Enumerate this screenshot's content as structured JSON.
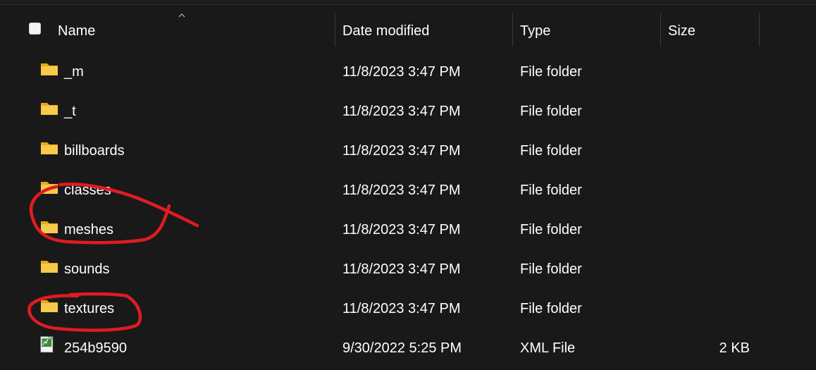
{
  "header": {
    "columns": [
      {
        "label": "Name"
      },
      {
        "label": "Date modified"
      },
      {
        "label": "Type"
      },
      {
        "label": "Size"
      }
    ],
    "sort_indicator_icon": "chevron-up-icon"
  },
  "rows": [
    {
      "name": "_m",
      "date": "11/8/2023 3:47 PM",
      "type": "File folder",
      "size": "",
      "icon": "folder-icon"
    },
    {
      "name": "_t",
      "date": "11/8/2023 3:47 PM",
      "type": "File folder",
      "size": "",
      "icon": "folder-icon"
    },
    {
      "name": "billboards",
      "date": "11/8/2023 3:47 PM",
      "type": "File folder",
      "size": "",
      "icon": "folder-icon"
    },
    {
      "name": "classes",
      "date": "11/8/2023 3:47 PM",
      "type": "File folder",
      "size": "",
      "icon": "folder-icon"
    },
    {
      "name": "meshes",
      "date": "11/8/2023 3:47 PM",
      "type": "File folder",
      "size": "",
      "icon": "folder-icon"
    },
    {
      "name": "sounds",
      "date": "11/8/2023 3:47 PM",
      "type": "File folder",
      "size": "",
      "icon": "folder-icon"
    },
    {
      "name": "textures",
      "date": "11/8/2023 3:47 PM",
      "type": "File folder",
      "size": "",
      "icon": "folder-icon"
    },
    {
      "name": "254b9590",
      "date": "9/30/2022 5:25 PM",
      "type": "XML File",
      "size": "2 KB",
      "icon": "xml-file-icon"
    }
  ],
  "colors": {
    "background": "#191919",
    "text": "#ffffff",
    "folder_yellow": "#f6c644",
    "annotation_red": "#e11b22"
  }
}
